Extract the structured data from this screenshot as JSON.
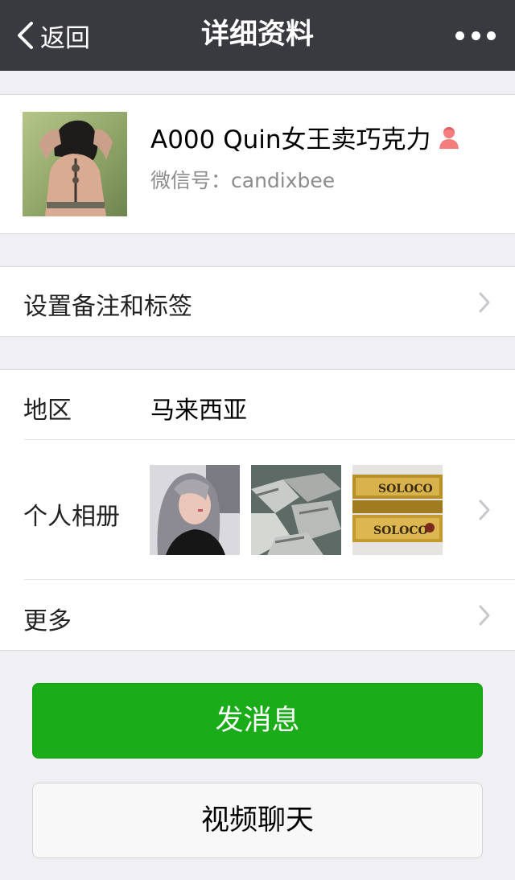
{
  "navbar": {
    "back_label": "返回",
    "title": "详细资料",
    "back_icon": "chevron-left-icon",
    "more_icon": "more-dots-icon"
  },
  "profile": {
    "name": "A000 Quin女王卖巧克力",
    "wechat_id_label": "微信号：",
    "wechat_id": "candixbee",
    "gender_icon": "female-person-icon",
    "gender_color": "#f37e7d"
  },
  "remark": {
    "label": "设置备注和标签"
  },
  "info": {
    "region_label": "地区",
    "region_value": "马来西亚",
    "album_label": "个人相册",
    "more_label": "更多"
  },
  "buttons": {
    "send_message": "发消息",
    "video_chat": "视频聊天"
  },
  "colors": {
    "navbar": "#393a3f",
    "primary_button": "#1aad19",
    "background": "#efeff4"
  }
}
